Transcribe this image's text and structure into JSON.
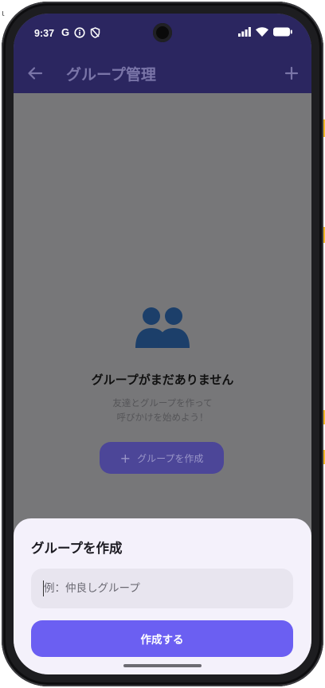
{
  "status_bar": {
    "time": "9:37",
    "google_icon": "G"
  },
  "app_bar": {
    "title": "グループ管理",
    "back_icon": "arrow-left-icon",
    "add_icon": "plus-icon"
  },
  "empty_state": {
    "icon": "people-icon",
    "title": "グループがまだありません",
    "description_line1": "友達とグループを作って",
    "description_line2": "呼びかけを始めよう！",
    "create_button_label": "グループを作成",
    "create_button_icon": "+"
  },
  "sheet": {
    "title": "グループを作成",
    "input_placeholder": "例：仲良しグループ",
    "input_value": "",
    "submit_label": "作成する"
  },
  "colors": {
    "app_bar": "#2b2660",
    "accent": "#6b5ff2",
    "sheet_bg": "#f4f1fb",
    "scrim": "#777779"
  }
}
